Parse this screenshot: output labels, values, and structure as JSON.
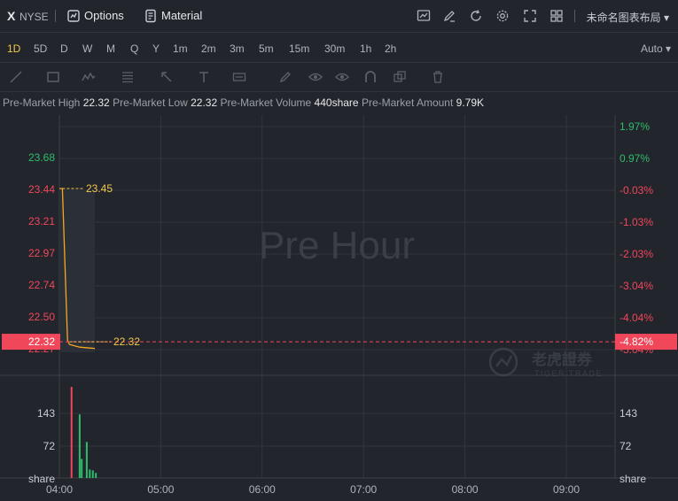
{
  "header": {
    "symbol": "X",
    "exchange": "NYSE",
    "options_label": "Options",
    "material_label": "Material",
    "layout_name": "未命名图表布局",
    "icons": [
      "chart-type-icon",
      "draw-icon",
      "refresh-icon",
      "settings-icon",
      "fullscreen-icon",
      "layout-grid-icon"
    ]
  },
  "timeframes": {
    "items": [
      "1D",
      "5D",
      "D",
      "W",
      "M",
      "Q",
      "Y",
      "1m",
      "2m",
      "3m",
      "5m",
      "15m",
      "30m",
      "1h",
      "2h"
    ],
    "active": "1D",
    "scale": "Auto"
  },
  "tools": [
    "line-tool-icon",
    "rectangle-tool-icon",
    "pattern-tool-icon",
    "fib-tool-icon",
    "arrow-tool-icon",
    "text-tool-icon",
    "measure-tool-icon",
    "pen-tool-icon",
    "visibility-icon",
    "magnet-icon",
    "layers-icon",
    "trash-icon"
  ],
  "premarket": {
    "high_label": "Pre-Market High",
    "high": "22.32",
    "low_label": "Pre-Market Low",
    "low": "22.32",
    "volume_label": "Pre-Market Volume",
    "volume": "440share",
    "amount_label": "Pre-Market Amount",
    "amount": "9.79K"
  },
  "chart_data": {
    "type": "line",
    "watermark": "Pre Hour",
    "brand": "老虎證券",
    "brand_sub": "TIGER TRADE",
    "x_ticks": [
      "04:00",
      "05:00",
      "06:00",
      "07:00",
      "08:00",
      "09:00"
    ],
    "y_ticks": [
      "23.68",
      "23.44",
      "23.21",
      "22.97",
      "22.74",
      "22.50",
      "22.27"
    ],
    "pct_ticks": [
      "1.97%",
      "0.97%",
      "-0.03%",
      "-1.03%",
      "-2.03%",
      "-3.04%",
      "-4.04%",
      "-5.04%"
    ],
    "current_price": "22.32",
    "current_pct": "-4.82%",
    "marker_high": "23.45",
    "marker_low": "22.32",
    "price_series": [
      [
        4.0,
        23.45
      ],
      [
        4.03,
        23.45
      ],
      [
        4.08,
        22.33
      ],
      [
        4.1,
        22.3
      ],
      [
        4.2,
        22.28
      ],
      [
        4.35,
        22.27
      ]
    ],
    "volume_ticks": [
      "143",
      "72",
      "share"
    ],
    "volume_bars": [
      [
        4.12,
        215,
        "red"
      ],
      [
        4.2,
        150,
        "green"
      ],
      [
        4.22,
        45,
        "green"
      ],
      [
        4.27,
        85,
        "green"
      ],
      [
        4.3,
        20,
        "green"
      ],
      [
        4.33,
        18,
        "green"
      ],
      [
        4.36,
        12,
        "green"
      ]
    ],
    "colors": {
      "up": "#2ebd6b",
      "down": "#f0475b",
      "line": "#f5a623",
      "marker": "#f2c94c",
      "current": "#f0475b"
    }
  }
}
